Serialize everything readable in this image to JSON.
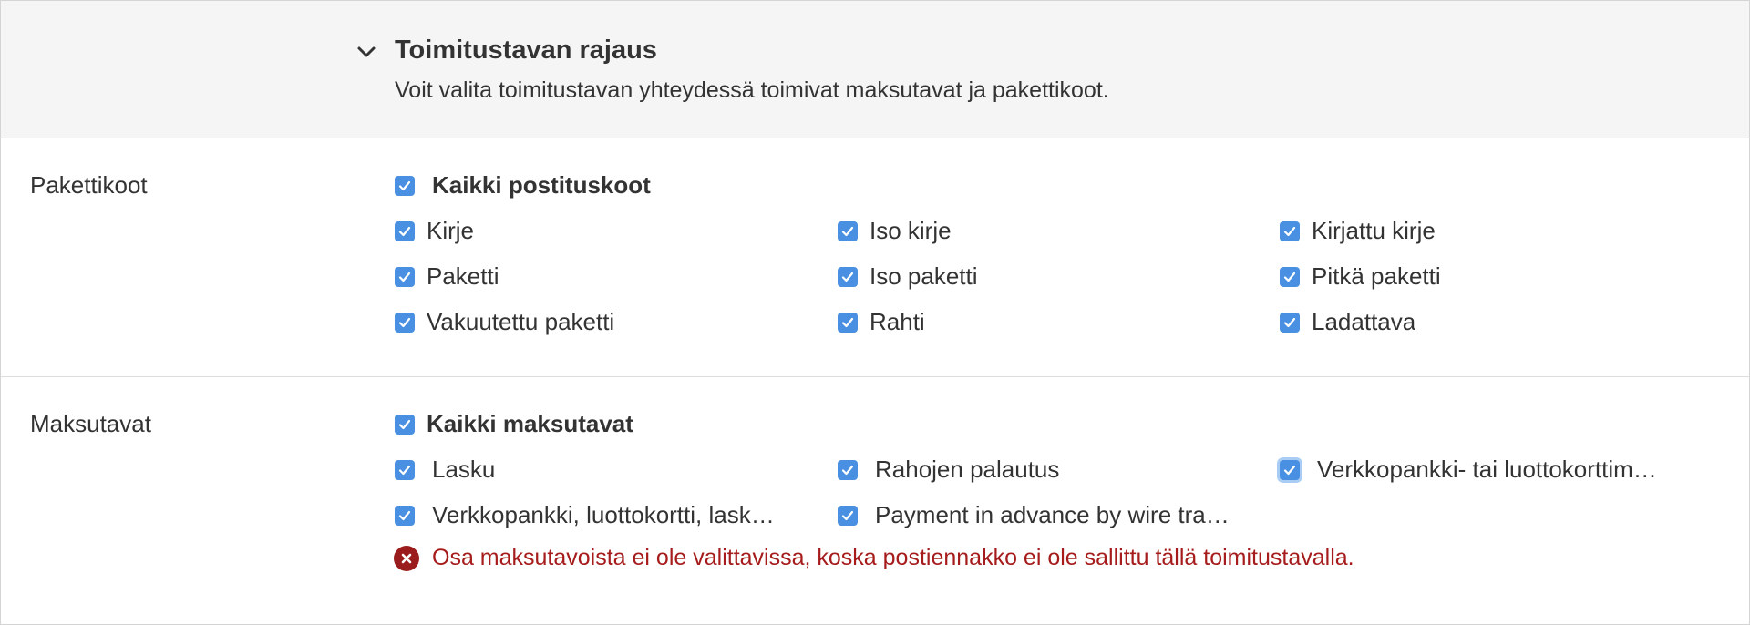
{
  "header": {
    "collapse_icon": "chevron-down-icon",
    "title": "Toimitustavan rajaus",
    "description": "Voit valita toimitustavan yhteydessä toimivat maksutavat ja pakettikoot."
  },
  "package_sizes": {
    "label": "Pakettikoot",
    "all_label": "Kaikki postituskoot",
    "all_checked": true,
    "items": [
      {
        "label": "Kirje",
        "checked": true
      },
      {
        "label": "Iso kirje",
        "checked": true
      },
      {
        "label": "Kirjattu kirje",
        "checked": true
      },
      {
        "label": "Paketti",
        "checked": true
      },
      {
        "label": "Iso paketti",
        "checked": true
      },
      {
        "label": "Pitkä paketti",
        "checked": true
      },
      {
        "label": "Vakuutettu paketti",
        "checked": true
      },
      {
        "label": "Rahti",
        "checked": true
      },
      {
        "label": "Ladattava",
        "checked": true
      }
    ]
  },
  "payment_methods": {
    "label": "Maksutavat",
    "all_label": "Kaikki maksutavat",
    "all_checked": true,
    "items": [
      {
        "label": "Lasku",
        "checked": true
      },
      {
        "label": "Rahojen palautus",
        "checked": true
      },
      {
        "label": "Verkkopankki- tai luottokorttim…",
        "checked": true
      },
      {
        "label": "Verkkopankki, luottokortti, lask…",
        "checked": true
      },
      {
        "label": "Payment in advance by wire tra…",
        "checked": true
      }
    ],
    "error_icon": "error-circle-icon",
    "error_text": "Osa maksutavoista ei ole valittavissa, koska postiennakko ei ole sallittu tällä toimitustavalla."
  },
  "colors": {
    "checkbox": "#4a90e2",
    "error": "#a61b1b",
    "header_bg": "#f5f5f5"
  }
}
